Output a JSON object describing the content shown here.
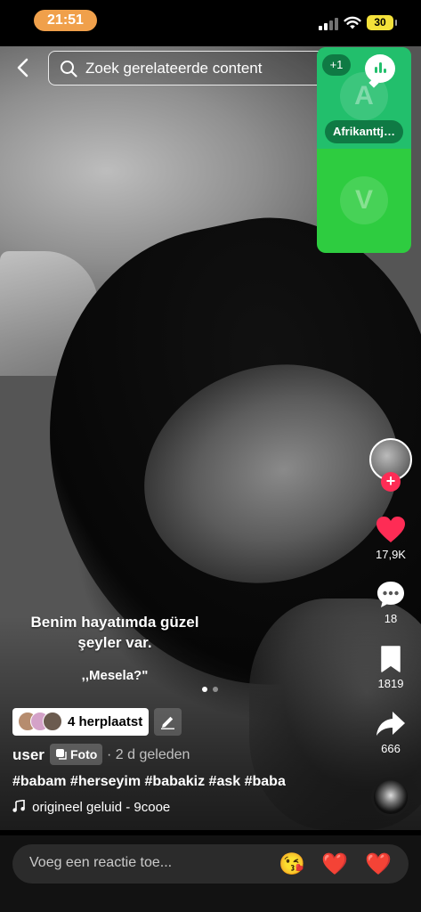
{
  "status_bar": {
    "time": "21:51",
    "battery": "30"
  },
  "header": {
    "search_placeholder": "Zoek gerelateerde content"
  },
  "voice_panel": {
    "plus_count": "+1",
    "avatar_top_letter": "A",
    "name": "Afrikanttj…",
    "avatar_bottom_letter": "V"
  },
  "post": {
    "caption_line1": "Benim hayatımda güzel",
    "caption_line2": "şeyler var.",
    "caption_quote": ",,Mesela?\"",
    "repost_label": "4 herplaatst",
    "username": "user",
    "type_label": "Foto",
    "time_ago": "· 2 d geleden",
    "hashtags": "#babam #herseyim #babakiz #ask #baba",
    "sound": "origineel geluid - 9cooe",
    "carousel_total": 2,
    "carousel_active": 1
  },
  "actions": {
    "likes": "17,9K",
    "comments": "18",
    "saves": "1819",
    "shares": "666"
  },
  "comment_bar": {
    "placeholder": "Voeg een reactie toe...",
    "emojis": [
      "😘",
      "❤️",
      "❤️"
    ]
  },
  "colors": {
    "time_pill": "#f0a04b",
    "battery": "#f4e13a",
    "like": "#fe2c55",
    "voice_green": "#2ecc40",
    "voice_green_dark": "#22bf6c"
  }
}
